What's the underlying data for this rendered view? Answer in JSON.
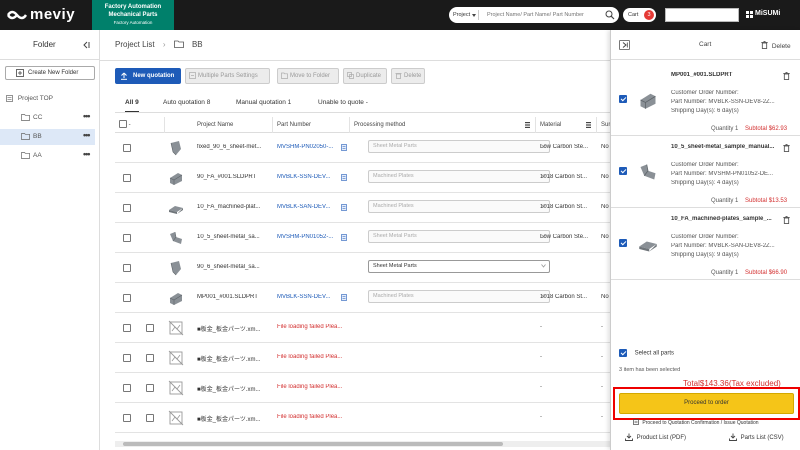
{
  "header": {
    "logo": "meviy",
    "fa_line1": "Factory Automation",
    "fa_line2": "Mechanical Parts",
    "fa_line3": "Factory Automation",
    "search_category": "Project",
    "search_placeholder": "Project Name/ Part Name/ Part Number",
    "cart_label": "Cart",
    "cart_count": "3",
    "brand": "MiSUMi"
  },
  "sidebar": {
    "title": "Folder",
    "new_folder_label": "Create New Folder",
    "root_label": "Project TOP",
    "folders": [
      {
        "label": "CC",
        "active": false
      },
      {
        "label": "BB",
        "active": true
      },
      {
        "label": "AA",
        "active": false
      }
    ]
  },
  "main": {
    "breadcrumb_root": "Project List",
    "breadcrumb_current": "BB",
    "toolbar": {
      "new_quotation": "New quotation",
      "multiple_settings": "Multiple Parts Settings",
      "move_to_folder": "Move to Folder",
      "duplicate": "Duplicate",
      "delete": "Delete"
    },
    "tabs": [
      {
        "label": "All 9",
        "active": true
      },
      {
        "label": "Auto quotation 8",
        "active": false
      },
      {
        "label": "Manual quotation 1",
        "active": false
      },
      {
        "label": "Unable to quote -",
        "active": false
      }
    ],
    "columns": {
      "select": "-",
      "project_name": "Project Name",
      "part_number": "Part Number",
      "processing": "Processing method",
      "material": "Material",
      "surface": "Sur"
    },
    "rows": [
      {
        "name": "fixed_90_6_sheet-met...",
        "part": "MVSHM-PN02050-...",
        "processing": "Sheet Metal Parts",
        "material": "Low Carbon Ste...",
        "surface": "No",
        "shape": "sheet",
        "enabled": false
      },
      {
        "name": "90_FA_#001.SLDPRT",
        "part": "MVBLK-SSN-DEV...",
        "processing": "Machined Plates",
        "material": "1018 Carbon St...",
        "surface": "No",
        "shape": "block",
        "enabled": false
      },
      {
        "name": "10_FA_machined-plat...",
        "part": "MVBLK-SAN-DEV...",
        "processing": "Machined Plates",
        "material": "1018 Carbon St...",
        "surface": "No",
        "shape": "plate",
        "enabled": false
      },
      {
        "name": "10_5_sheet-metal_sa...",
        "part": "MVSHM-PN01052-...",
        "processing": "Sheet Metal Parts",
        "material": "Low Carbon Ste...",
        "surface": "No",
        "shape": "bracket",
        "enabled": false
      },
      {
        "name": "90_6_sheet-metal_sa...",
        "part": "",
        "processing": "Sheet Metal Parts",
        "material": "",
        "surface": "",
        "shape": "sheet",
        "enabled": true
      },
      {
        "name": "MP001_#001.SLDPRT",
        "part": "MVBLK-SSN-DEV...",
        "processing": "Machined Plates",
        "material": "1018 Carbon St...",
        "surface": "No",
        "shape": "block",
        "enabled": false
      }
    ],
    "failed_rows": [
      {
        "name": "■板金_板金パーツ.xm...",
        "error": "File loading failed Plea...",
        "material": "-",
        "surface": "-"
      },
      {
        "name": "■板金_板金パーツ.xm...",
        "error": "File loading failed Plea...",
        "material": "-",
        "surface": "-"
      },
      {
        "name": "■板金_板金パーツ.xm...",
        "error": "File loading failed Plea...",
        "material": "-",
        "surface": "-"
      },
      {
        "name": "■板金_板金パーツ.xm...",
        "error": "File loading failed Plea...",
        "material": "-",
        "surface": "-"
      }
    ]
  },
  "cart": {
    "title": "Cart",
    "delete_label": "Delete",
    "labels": {
      "order_no": "Customer Order Number:",
      "part_no": "Part Number:",
      "shipping": "Shipping Day(s):",
      "quantity": "Quantity",
      "subtotal": "Subtotal"
    },
    "items": [
      {
        "name": "MP001_#001.SLDPRT",
        "part_number": "MVBLK-SSN-DEV8-2Z...",
        "shipping": "6 day(s)",
        "quantity": "1",
        "subtotal": "$62.93"
      },
      {
        "name": "10_5_sheet-metal_sample_manual...",
        "part_number": "MVSHM-PN01052-DE...",
        "shipping": "4 day(s)",
        "quantity": "1",
        "subtotal": "$13.53"
      },
      {
        "name": "10_FA_machined-plates_sample_...",
        "part_number": "MVBLK-SAN-DEV8-2Z...",
        "shipping": "9 day(s)",
        "quantity": "1",
        "subtotal": "$66.90"
      }
    ],
    "select_all": "Select all parts",
    "selected_count": "3 item has been selected",
    "total": "Total$143.36(Tax excluded)",
    "proceed": "Proceed to order",
    "quotation_link": "Proceed to Quotation Confirmation / Issue Quotation",
    "product_list": "Product List (PDF)",
    "parts_list": "Parts List (CSV)"
  },
  "colors": {
    "header_bg": "#1a1a1a",
    "fa_green": "#00806b",
    "primary_blue": "#1e5bb8",
    "accent_yellow": "#f5c518",
    "error_red": "#d32f2f",
    "highlight_red": "#ee0000"
  }
}
